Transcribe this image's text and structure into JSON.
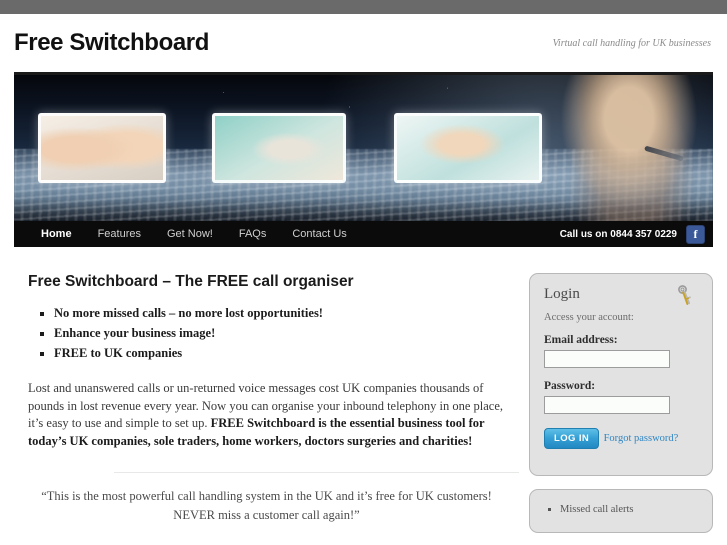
{
  "header": {
    "title": "Free Switchboard",
    "tagline": "Virtual call handling for UK businesses"
  },
  "nav": {
    "items": [
      {
        "label": "Home",
        "active": true
      },
      {
        "label": "Features",
        "active": false
      },
      {
        "label": "Get Now!",
        "active": false
      },
      {
        "label": "FAQs",
        "active": false
      },
      {
        "label": "Contact Us",
        "active": false
      }
    ],
    "call_text": "Call us on 0844 357 0229",
    "facebook_letter": "f"
  },
  "content": {
    "heading": "Free Switchboard – The FREE call organiser",
    "bullets": [
      "No more missed calls – no more lost opportunities!",
      "Enhance your business image!",
      "FREE to UK companies"
    ],
    "paragraph_regular": "Lost and unanswered calls or un-returned voice messages cost UK companies thousands of pounds in lost revenue every year. Now you can organise your inbound telephony in one place, it’s easy to use and simple to set up. ",
    "paragraph_bold": "FREE Switchboard is the essential business tool for today’s UK companies, sole traders, home workers, doctors surgeries and charities!",
    "quote_line_1": "“This is the most powerful call handling system in the UK and it’s free for UK customers!",
    "quote_line_2": "NEVER miss a customer call again!”"
  },
  "login": {
    "title": "Login",
    "subtitle": "Access your account:",
    "email_label": "Email address:",
    "email_value": "",
    "email_placeholder": "",
    "password_label": "Password:",
    "password_value": "",
    "password_placeholder": "",
    "button_label": "LOG IN",
    "forgot_label": "Forgot password?"
  },
  "features_panel": {
    "items": [
      "Missed call alerts"
    ]
  },
  "colors": {
    "nav_background": "#0b0b0b",
    "facebook_blue": "#3b5998",
    "button_blue": "#35a0d4",
    "link_blue": "#2f86c4",
    "panel_background": "#e2e2e2"
  }
}
